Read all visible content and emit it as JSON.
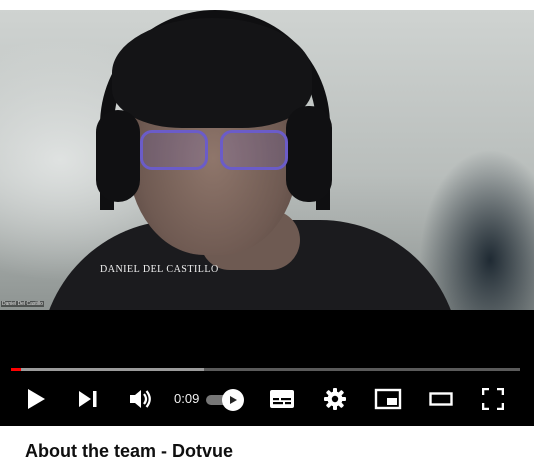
{
  "video": {
    "name_overlay": "DANIEL DEL CASTILLO",
    "corner_label": "Daniel Del Castillo"
  },
  "player": {
    "time": "0:09",
    "progress_played": 0.02,
    "progress_buffered": 0.38,
    "autoplay_on": true,
    "accent_color": "#ff0000",
    "controls": [
      {
        "name": "play-button",
        "icon": "play-icon"
      },
      {
        "name": "next-button",
        "icon": "skip-next-icon"
      },
      {
        "name": "volume-button",
        "icon": "volume-icon"
      },
      {
        "name": "subtitles-button",
        "icon": "subtitles-icon"
      },
      {
        "name": "settings-button",
        "icon": "gear-icon"
      },
      {
        "name": "miniplayer-button",
        "icon": "miniplayer-icon"
      },
      {
        "name": "theater-button",
        "icon": "theater-mode-icon"
      },
      {
        "name": "fullscreen-button",
        "icon": "fullscreen-icon"
      }
    ]
  },
  "title": "About the team - Dotvue"
}
